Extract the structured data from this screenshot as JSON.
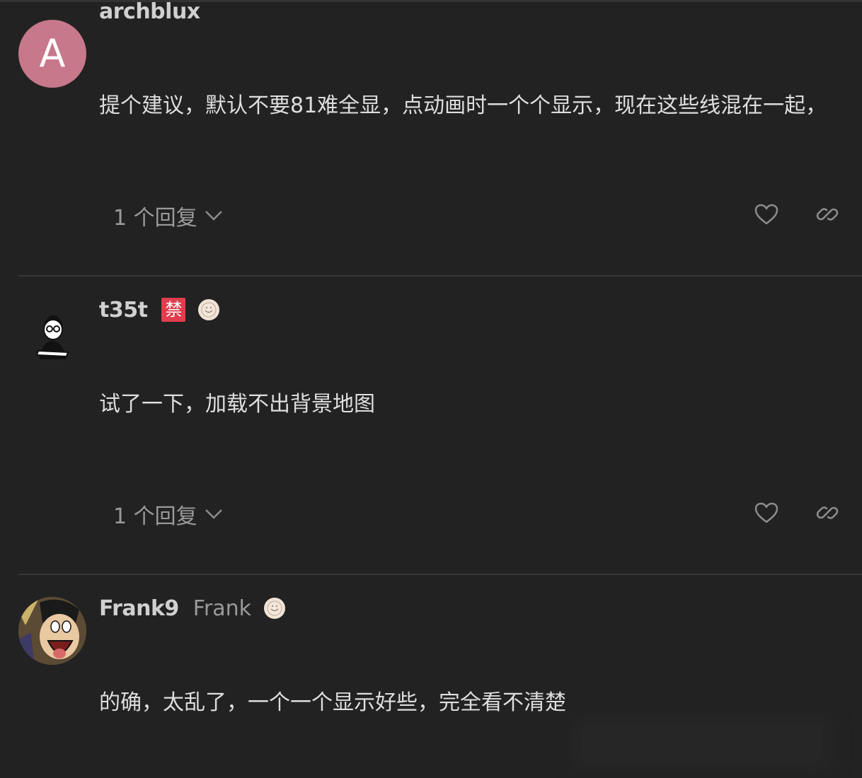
{
  "theme": {
    "background": "#222222",
    "text": "#dedede",
    "muted": "#9a9a9a",
    "ban_badge": "#e23d4d",
    "avatar_archblux": "#c7788a"
  },
  "posts": [
    {
      "username": "archblux",
      "avatar_letter": "A",
      "content": "提个建议，默认不要81难全显，点动画时一个个显示，现在这些线混在一起，",
      "replies_label": "1 个回复",
      "like_icon": "heart-icon",
      "share_icon": "link-icon"
    },
    {
      "username": "t35t",
      "ban_flair": "禁",
      "flair_icon": "emoji-flair-icon",
      "content": "试了一下，加载不出背景地图",
      "replies_label": "1 个回复",
      "like_icon": "heart-icon",
      "share_icon": "link-icon"
    },
    {
      "username": "Frank9",
      "fullname": "Frank",
      "flair_icon": "emoji-flair-icon",
      "content": "的确，太乱了，一个一个显示好些，完全看不清楚"
    }
  ]
}
